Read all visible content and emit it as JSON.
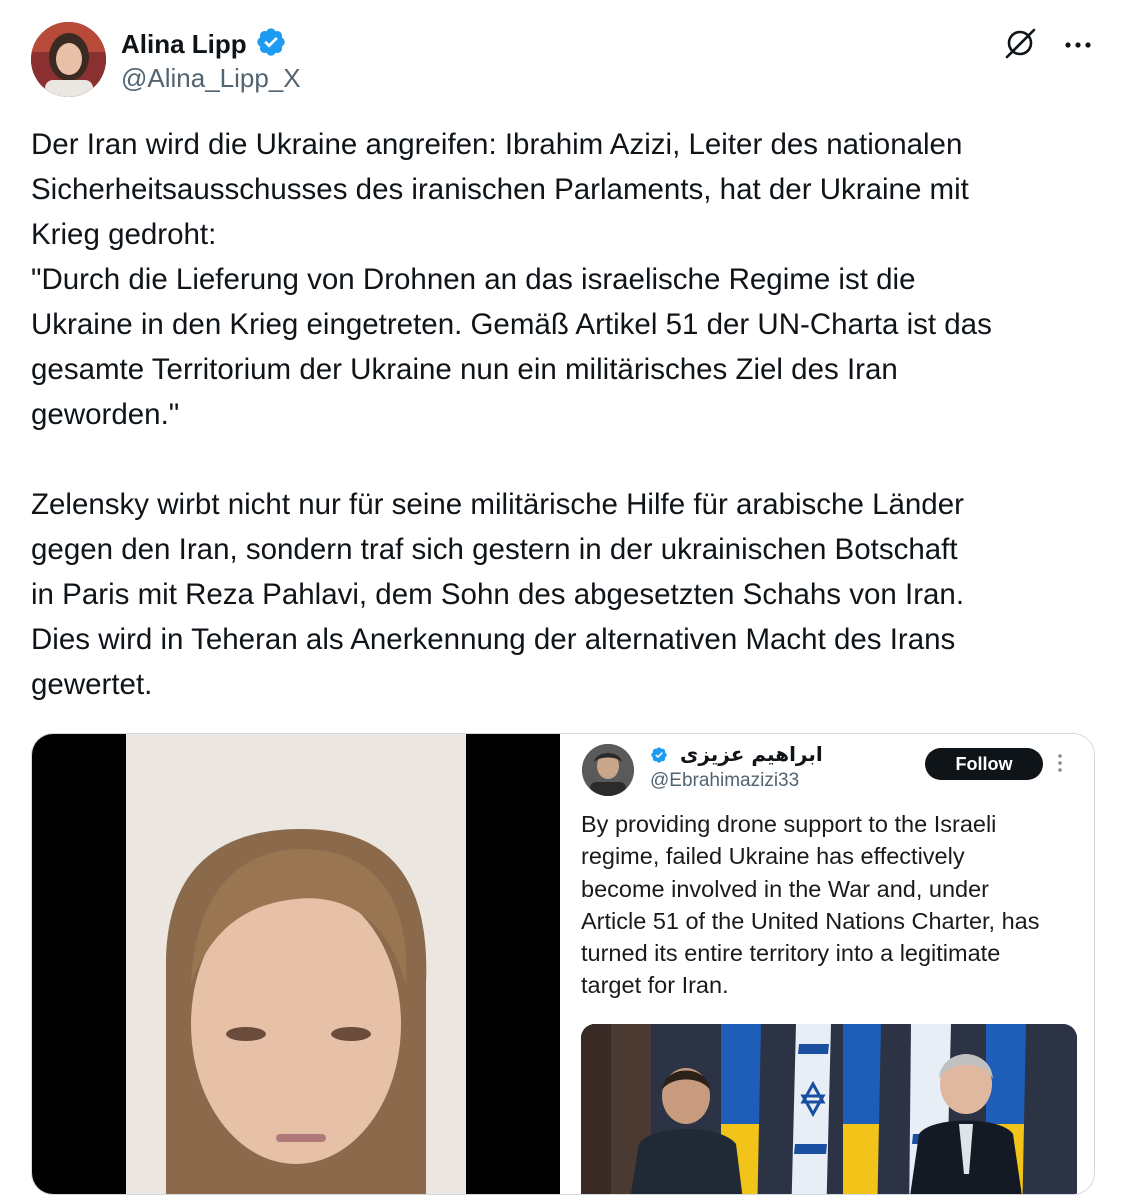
{
  "author": {
    "display_name": "Alina Lipp",
    "handle": "@Alina_Lipp_X",
    "verified": true,
    "avatar_icon": "profile-photo"
  },
  "top_actions": {
    "grok_icon": "grok-icon",
    "more_icon": "more-horizontal-icon"
  },
  "tweet": {
    "text": "Der Iran wird die Ukraine angreifen: Ibrahim Azizi, Leiter des nationalen\nSicherheitsausschusses des iranischen Parlaments, hat der Ukraine mit\nKrieg gedroht:\n\"Durch die Lieferung von Drohnen an das israelische Regime ist die\nUkraine in den Krieg eingetreten. Gemäß Artikel 51 der UN-Charta ist das\ngesamte Territorium der Ukraine nun ein militärisches Ziel des Iran\ngeworden.\"\n\nZelensky wirbt nicht nur für seine militärische Hilfe für arabische Länder\ngegen den Iran, sondern traf sich gestern in der ukrainischen Botschaft\nin Paris mit Reza Pahlavi, dem Sohn des abgesetzten Schahs von Iran.\nDies wird in Teheran als Anerkennung der alternativen Macht des Irans\ngewertet."
  },
  "embedded_screenshot": {
    "name": "ابراهیم عزیزی",
    "handle": "@Ebrahimazizi33",
    "follow_label": "Follow",
    "text": "By providing drone support to the Israeli\nregime, failed Ukraine has effectively\nbecome involved in the War and, under\nArticle 51 of the United Nations Charter, has\nturned its entire territory into a legitimate\ntarget for Iran."
  },
  "colors": {
    "verified_blue": "#1d9bf0",
    "text_primary": "#0f1419",
    "text_secondary": "#536471"
  }
}
